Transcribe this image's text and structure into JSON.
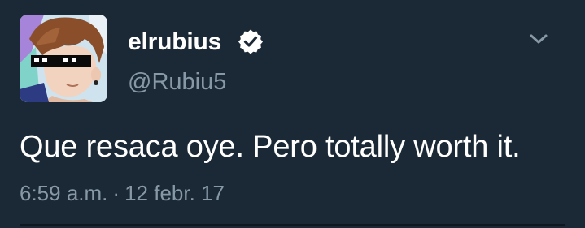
{
  "tweet": {
    "display_name": "elrubius",
    "handle": "@Rubiu5",
    "verified": true,
    "text": "Que resaca oye. Pero totally worth it.",
    "time": "6:59 a.m.",
    "separator": "·",
    "date": "12 febr. 17"
  },
  "icons": {
    "avatar": "avatar-icon",
    "verified": "verified-badge-icon",
    "menu": "chevron-down-icon"
  },
  "colors": {
    "background": "#1b2836",
    "primary_text": "#ffffff",
    "secondary_text": "#8899a6"
  }
}
